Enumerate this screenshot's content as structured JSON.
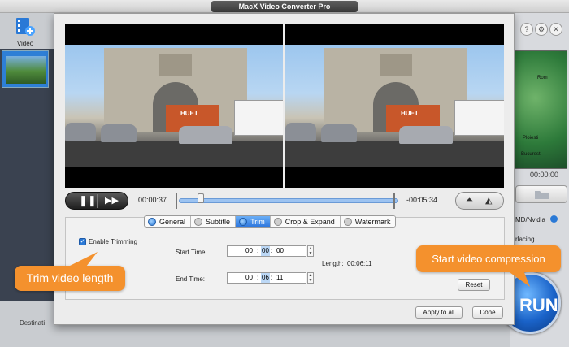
{
  "window": {
    "title": "MacX Video Converter Pro"
  },
  "toolbar": {
    "video_label": "Video"
  },
  "background": {
    "timecode": "00:00:00",
    "hw_text": "MD/Nvidia",
    "deint_text": "rlacing",
    "destination_label": "Destinati",
    "run_label": "RUN",
    "map_labels": [
      "Rom",
      "Ploiesti",
      "Bucurest"
    ]
  },
  "player": {
    "current_time": "00:00:37",
    "remaining_time": "-00:05:34",
    "progress": 0.1
  },
  "tabs": [
    {
      "label": "General",
      "active": false
    },
    {
      "label": "Subtitle",
      "active": false
    },
    {
      "label": "Trim",
      "active": true
    },
    {
      "label": "Crop & Expand",
      "active": false
    },
    {
      "label": "Watermark",
      "active": false
    }
  ],
  "trim": {
    "enable_label": "Enable Trimming",
    "enabled": true,
    "start_label": "Start Time:",
    "start": {
      "h": "00",
      "m": "00",
      "s": "00"
    },
    "end_label": "End Time:",
    "end": {
      "h": "00",
      "m": "06",
      "s": "11"
    },
    "length_label": "Length:",
    "length_value": "00:06:11",
    "reset_label": "Reset"
  },
  "footer": {
    "apply_all_label": "Apply to all",
    "done_label": "Done"
  },
  "video_overlay": {
    "truck_text": "HUET"
  },
  "callouts": {
    "trim": "Trim video length",
    "compress": "Start video compression",
    "color": "#f4912d"
  }
}
